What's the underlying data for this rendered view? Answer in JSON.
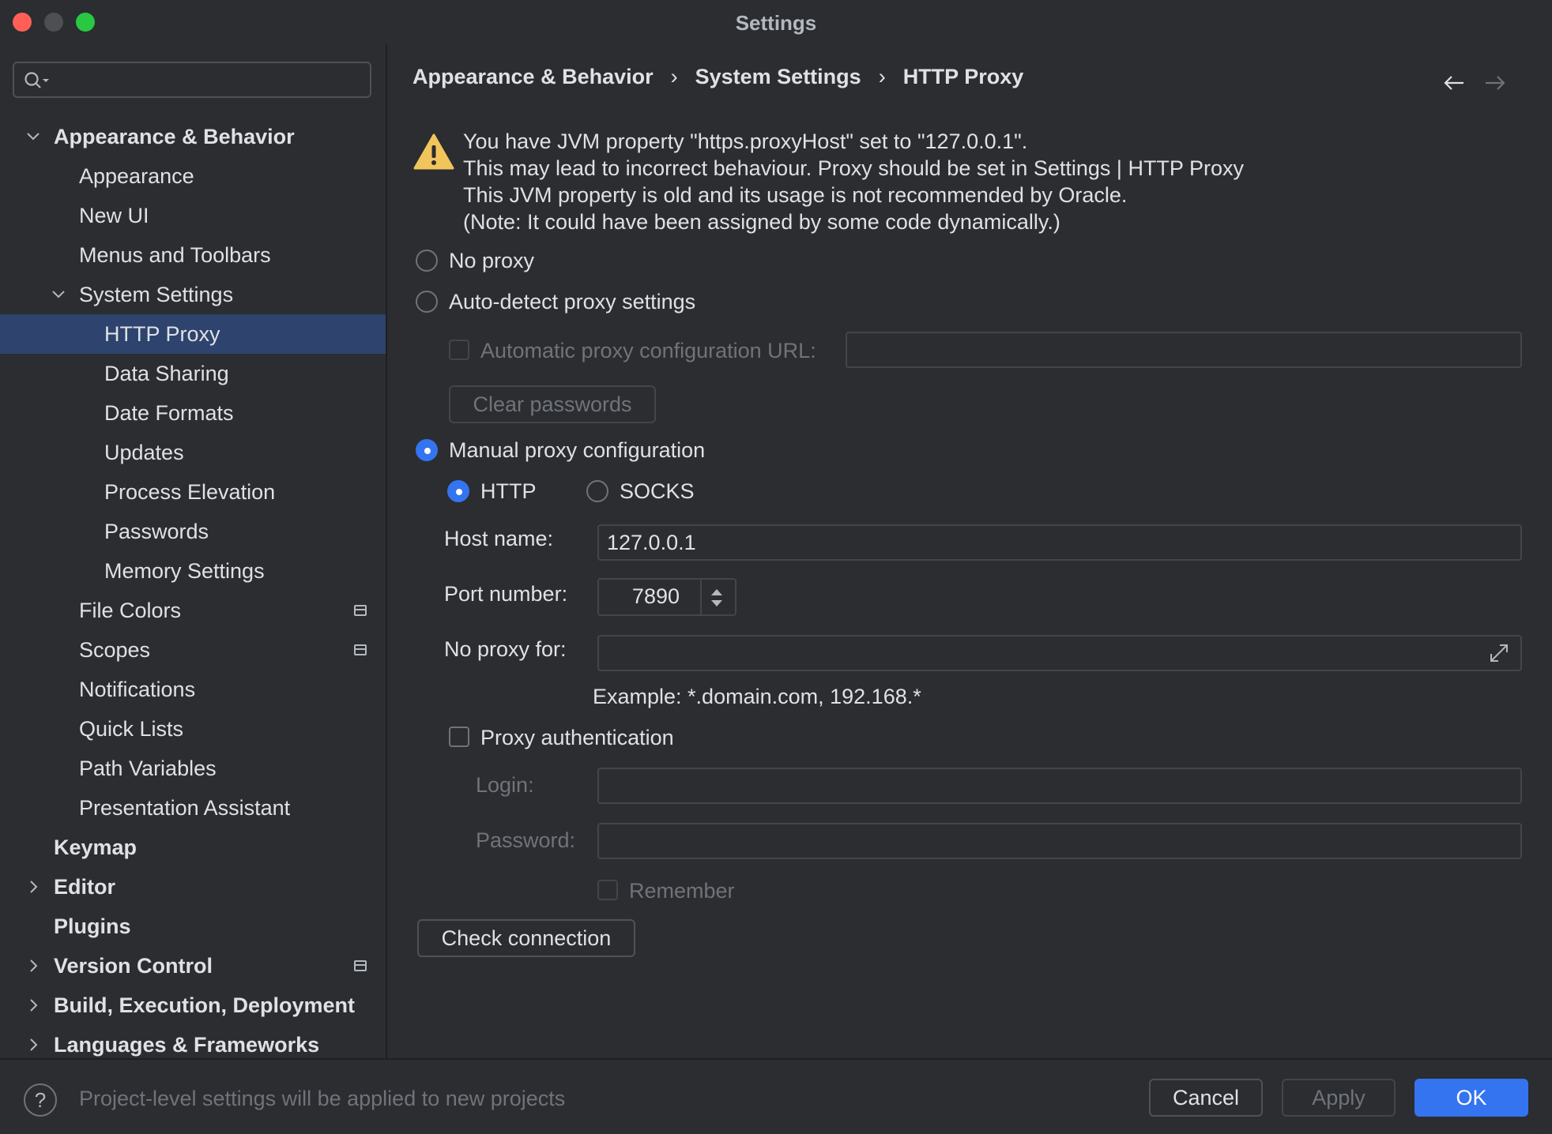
{
  "window": {
    "title": "Settings"
  },
  "sidebar": {
    "search_placeholder": "",
    "items": [
      {
        "label": "Appearance & Behavior",
        "level": 0,
        "bold": true,
        "chevron": "down"
      },
      {
        "label": "Appearance",
        "level": 1
      },
      {
        "label": "New UI",
        "level": 1
      },
      {
        "label": "Menus and Toolbars",
        "level": 1
      },
      {
        "label": "System Settings",
        "level": 1,
        "chevron": "down"
      },
      {
        "label": "HTTP Proxy",
        "level": 2,
        "selected": true
      },
      {
        "label": "Data Sharing",
        "level": 2
      },
      {
        "label": "Date Formats",
        "level": 2
      },
      {
        "label": "Updates",
        "level": 2
      },
      {
        "label": "Process Elevation",
        "level": 2
      },
      {
        "label": "Passwords",
        "level": 2
      },
      {
        "label": "Memory Settings",
        "level": 2
      },
      {
        "label": "File Colors",
        "level": 1,
        "badge": true
      },
      {
        "label": "Scopes",
        "level": 1,
        "badge": true
      },
      {
        "label": "Notifications",
        "level": 1
      },
      {
        "label": "Quick Lists",
        "level": 1
      },
      {
        "label": "Path Variables",
        "level": 1
      },
      {
        "label": "Presentation Assistant",
        "level": 1
      },
      {
        "label": "Keymap",
        "level": 0,
        "bold": true
      },
      {
        "label": "Editor",
        "level": 0,
        "bold": true,
        "chevron": "right"
      },
      {
        "label": "Plugins",
        "level": 0,
        "bold": true
      },
      {
        "label": "Version Control",
        "level": 0,
        "bold": true,
        "chevron": "right",
        "badge": true
      },
      {
        "label": "Build, Execution, Deployment",
        "level": 0,
        "bold": true,
        "chevron": "right"
      },
      {
        "label": "Languages & Frameworks",
        "level": 0,
        "bold": true,
        "chevron": "right"
      }
    ]
  },
  "breadcrumb": [
    "Appearance & Behavior",
    "System Settings",
    "HTTP Proxy"
  ],
  "warning": {
    "icon": "warning-triangle-icon",
    "lines": [
      "You have JVM property \"https.proxyHost\" set to \"127.0.0.1\".",
      "This may lead to incorrect behaviour. Proxy should be set in Settings | HTTP Proxy",
      "This JVM property is old and its usage is not recommended by Oracle.",
      "(Note: It could have been assigned by some code dynamically.)"
    ]
  },
  "proxy": {
    "no_proxy_label": "No proxy",
    "auto_detect_label": "Auto-detect proxy settings",
    "auto_config_url_label": "Automatic proxy configuration URL:",
    "auto_config_url_value": "",
    "clear_passwords_label": "Clear passwords",
    "manual_label": "Manual proxy configuration",
    "http_label": "HTTP",
    "socks_label": "SOCKS",
    "host_label": "Host name:",
    "host_value": "127.0.0.1",
    "port_label": "Port number:",
    "port_value": "7890",
    "no_proxy_for_label": "No proxy for:",
    "no_proxy_for_value": "",
    "example_text": "Example: *.domain.com, 192.168.*",
    "auth_label": "Proxy authentication",
    "login_label": "Login:",
    "login_value": "",
    "password_label": "Password:",
    "password_value": "",
    "remember_label": "Remember",
    "check_connection_label": "Check connection"
  },
  "footer": {
    "help_glyph": "?",
    "text": "Project-level settings will be applied to new projects",
    "cancel_label": "Cancel",
    "apply_label": "Apply",
    "ok_label": "OK"
  },
  "colors": {
    "accent": "#3574f0",
    "selection": "#2e436e",
    "warning": "#f2c55c"
  }
}
